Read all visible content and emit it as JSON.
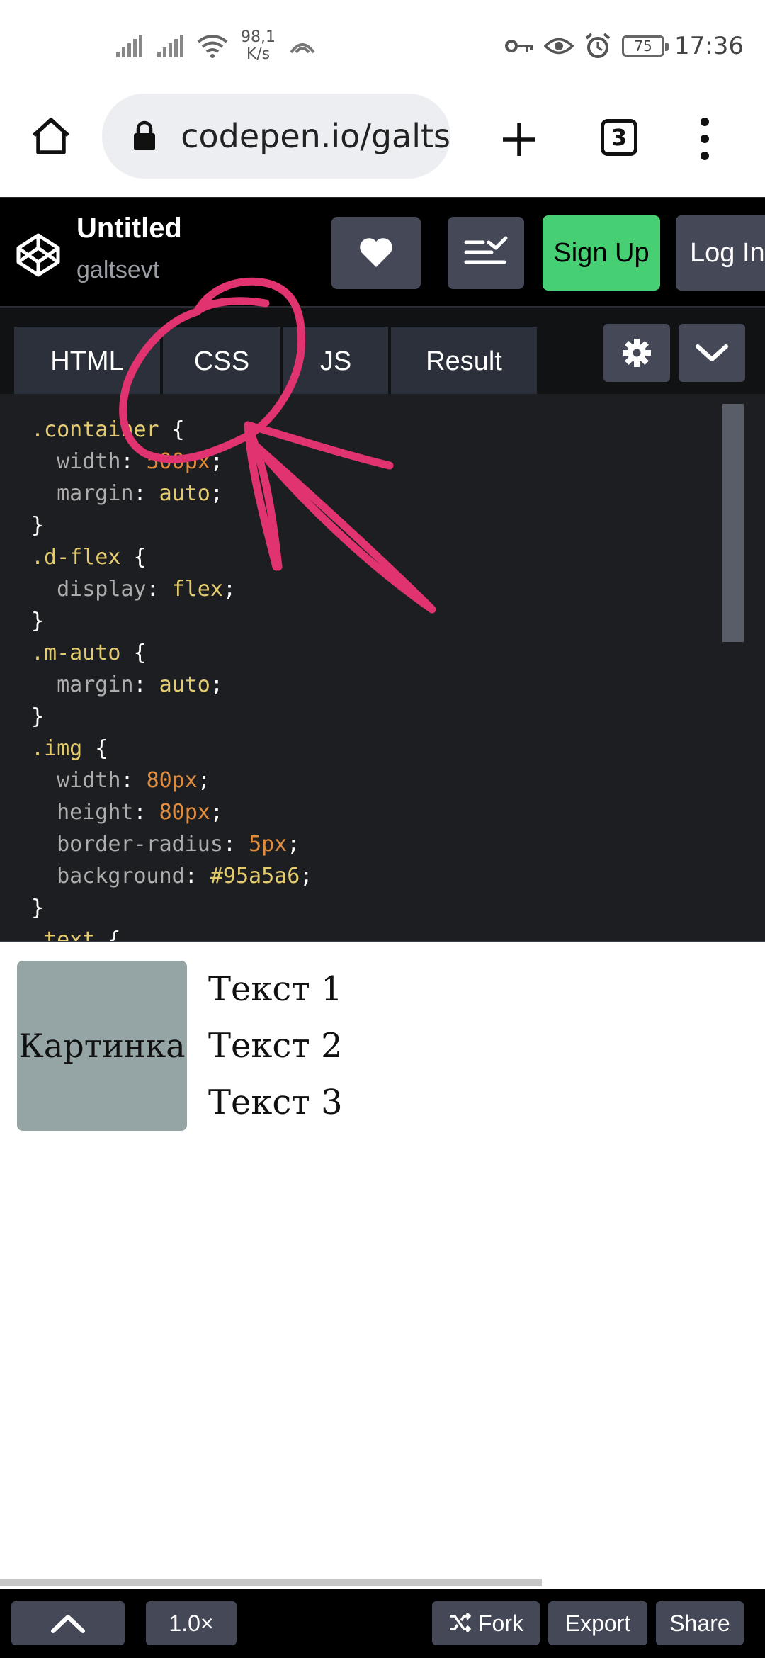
{
  "status_bar": {
    "net_speed_value": "98,1",
    "net_speed_unit": "K/s",
    "battery": "75",
    "time": "17:36",
    "icons": [
      "signal-icon",
      "signal-icon",
      "wifi-icon",
      "hotspot-icon",
      "key-icon",
      "eye-icon",
      "alarm-icon",
      "battery-icon"
    ]
  },
  "browser": {
    "url": "codepen.io/galts",
    "tab_count": "3",
    "icons": [
      "home-icon",
      "lock-icon",
      "plus-icon",
      "menu-dots-icon"
    ]
  },
  "codepen": {
    "title": "Untitled",
    "user": "galtsevt",
    "signup_label": "Sign Up",
    "login_label": "Log In",
    "brand_color": "#47cf73"
  },
  "editor": {
    "tabs": [
      {
        "label": "HTML"
      },
      {
        "label": "CSS"
      },
      {
        "label": "JS"
      },
      {
        "label": "Result"
      }
    ],
    "active_tab": "CSS"
  },
  "code_lines": [
    ".container {",
    "  width: 500px;",
    "  margin: auto;",
    "}",
    ".d-flex {",
    "  display: flex;",
    "}",
    ".m-auto {",
    "  margin: auto;",
    "}",
    ".img {",
    "  width: 80px;",
    "  height: 80px;",
    "  border-radius: 5px;",
    "  background: #95a5a6;",
    "}",
    ".text {"
  ],
  "result": {
    "image_label": "Картинка",
    "image_bg": "#95a5a6",
    "texts": [
      "Текст 1",
      "Текст 2",
      "Текст 3"
    ]
  },
  "bottom_bar": {
    "zoom": "1.0×",
    "fork_label": "Fork",
    "export_label": "Export",
    "share_label": "Share"
  },
  "annotation_color": "#e0336f"
}
